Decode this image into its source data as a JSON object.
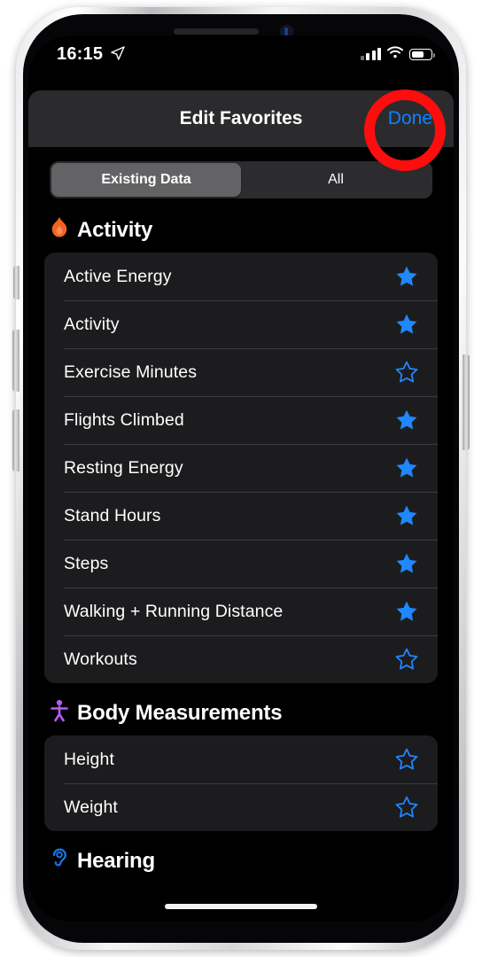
{
  "status_bar": {
    "time": "16:15",
    "location_icon": "location-arrow-icon",
    "signal_icon": "cellular-signal-icon",
    "wifi_icon": "wifi-icon",
    "battery_icon": "battery-icon"
  },
  "nav": {
    "title": "Edit Favorites",
    "done_label": "Done"
  },
  "segmented": {
    "options": [
      {
        "label": "Existing Data",
        "selected": true
      },
      {
        "label": "All",
        "selected": false
      }
    ]
  },
  "sections": [
    {
      "title": "Activity",
      "icon": "flame-icon",
      "icon_color": "#f4631e",
      "items": [
        {
          "label": "Active Energy",
          "favorite": true
        },
        {
          "label": "Activity",
          "favorite": true
        },
        {
          "label": "Exercise Minutes",
          "favorite": false
        },
        {
          "label": "Flights Climbed",
          "favorite": true
        },
        {
          "label": "Resting Energy",
          "favorite": true
        },
        {
          "label": "Stand Hours",
          "favorite": true
        },
        {
          "label": "Steps",
          "favorite": true
        },
        {
          "label": "Walking + Running Distance",
          "favorite": true
        },
        {
          "label": "Workouts",
          "favorite": false
        }
      ]
    },
    {
      "title": "Body Measurements",
      "icon": "body-person-icon",
      "icon_color": "#b75cf0",
      "items": [
        {
          "label": "Height",
          "favorite": false
        },
        {
          "label": "Weight",
          "favorite": false
        }
      ]
    },
    {
      "title": "Hearing",
      "icon": "ear-icon",
      "icon_color": "#1b74e4",
      "items": []
    }
  ],
  "colors": {
    "accent_blue": "#0a84ff",
    "star_blue": "#1f87ff",
    "annotation_red": "#fd0d0d",
    "card_bg": "#1c1c1e",
    "navbar_bg": "#2b2b2d",
    "segment_track": "#2c2c2e",
    "segment_selected": "#636366"
  },
  "annotation": {
    "shape": "circle",
    "target": "Done"
  }
}
